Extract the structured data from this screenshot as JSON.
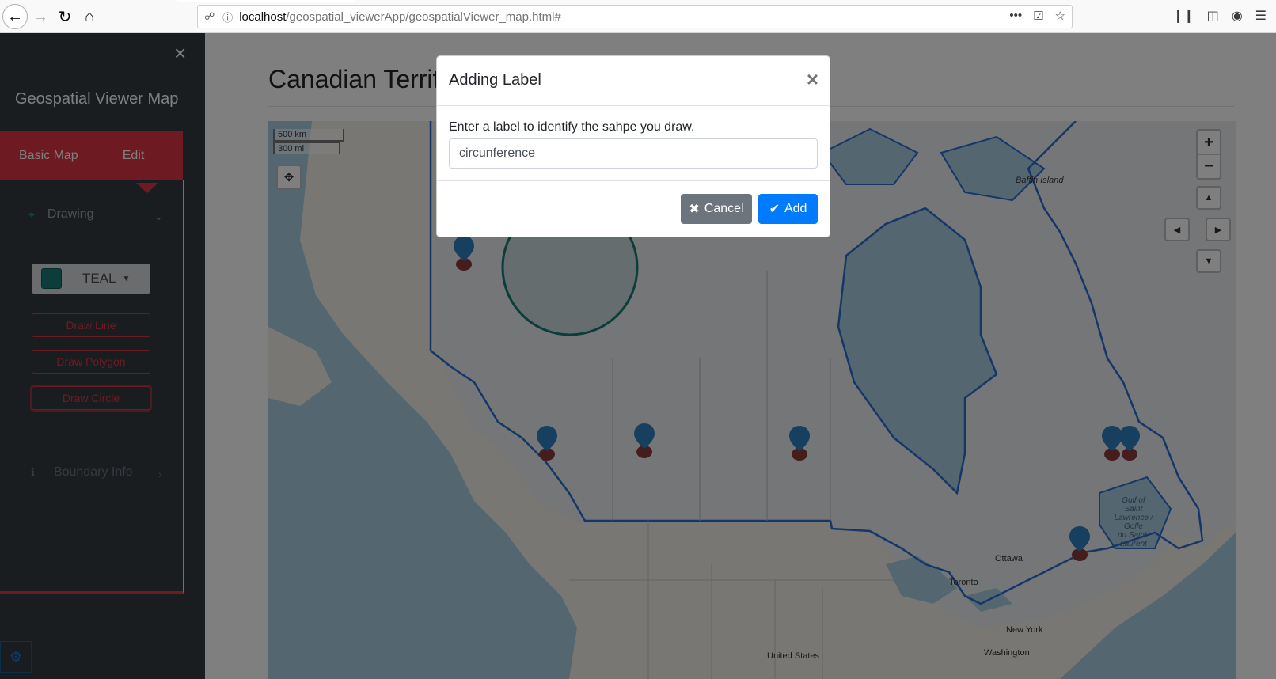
{
  "browser": {
    "url_host": "localhost",
    "url_path": "/geospatial_viewerApp/geospatialViewer_map.html#",
    "more_icon": "•••"
  },
  "sidebar": {
    "close_symbol": "×",
    "title": "Geospatial Viewer Map",
    "tabs": [
      {
        "label": "Basic Map"
      },
      {
        "label": "Edit"
      }
    ],
    "drawing": {
      "label": "Drawing",
      "color": {
        "name": "TEAL",
        "hex": "#1a7b76"
      },
      "buttons": [
        {
          "label": "Draw Line"
        },
        {
          "label": "Draw Polygon"
        },
        {
          "label": "Draw Circle"
        }
      ]
    },
    "boundary_info": {
      "label": "Boundary Info"
    }
  },
  "main": {
    "title": "Canadian Territ",
    "map": {
      "scale_km": "500 km",
      "scale_mi": "300 mi",
      "labels": {
        "baffin": "Baffin Island",
        "ottawa": "Ottawa",
        "toronto": "Toronto",
        "new_york": "New York",
        "washington": "Washington",
        "united_states": "United States",
        "gulf": "Gulf of Saint Lawrence / Golfe du Saint-Laurent"
      },
      "gulf_lines": [
        "Gulf of",
        "Saint",
        "Lawrence /",
        "Golfe",
        "du Saint-",
        "Laurent"
      ],
      "zoom_in": "+",
      "zoom_out": "−"
    }
  },
  "modal": {
    "title": "Adding Label",
    "close": "×",
    "prompt": "Enter a label to identify the sahpe you draw.",
    "input_value": "circunference",
    "cancel_label": "Cancel",
    "add_label": "Add"
  },
  "colors": {
    "accent_red": "#dc3545",
    "sidebar_bg": "#343a40",
    "primary_blue": "#007bff",
    "boundary_blue": "#2a6fd0"
  }
}
